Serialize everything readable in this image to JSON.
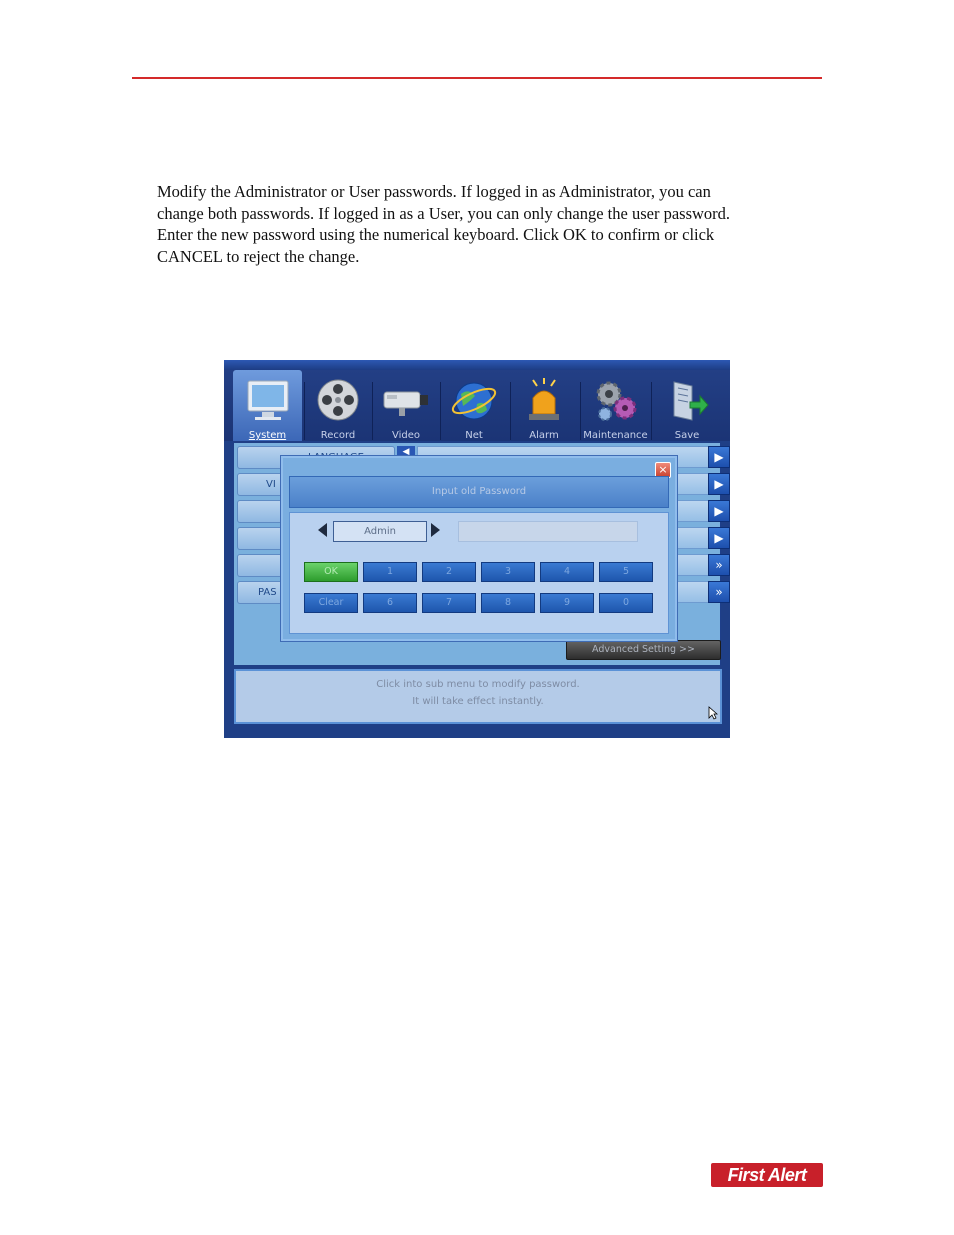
{
  "document": {
    "paragraph_lines": [
      "Modify the Administrator or User passwords. If logged in as Administrator, you can",
      "change both passwords. If logged in as a User, you can only change the user password.",
      "Enter the new password using the numerical keyboard. Click OK to confirm or click",
      "CANCEL to reject the change."
    ],
    "logo_text": "First Alert"
  },
  "colors": {
    "header_rule": "#d42a2a",
    "brand_red": "#c8202a",
    "dvr_navy": "#1f3f86",
    "dvr_light_blue": "#7ab0dd",
    "ok_green": "#3fb23f"
  },
  "dvr": {
    "toolbar": [
      {
        "label": "System",
        "icon": "monitor-icon",
        "active": true
      },
      {
        "label": "Record",
        "icon": "film-reel-icon",
        "active": false
      },
      {
        "label": "Video",
        "icon": "camera-icon",
        "active": false
      },
      {
        "label": "Net",
        "icon": "globe-icon",
        "active": false
      },
      {
        "label": "Alarm",
        "icon": "siren-icon",
        "active": false
      },
      {
        "label": "Maintenance",
        "icon": "gears-icon",
        "active": false
      },
      {
        "label": "Save",
        "icon": "save-folder-icon",
        "active": false
      }
    ],
    "left_menu": [
      "LANGUAGE",
      "VI",
      "",
      "",
      "",
      "PAS"
    ],
    "advanced_button": "Advanced Setting >>",
    "footer_lines": [
      "Click into sub menu to modify password.",
      "It will take effect instantly."
    ],
    "dialog": {
      "title": "Input old Password",
      "close_glyph": "×",
      "user_value": "Admin",
      "keys_row1": [
        "OK",
        "1",
        "2",
        "3",
        "4",
        "5"
      ],
      "keys_row2": [
        "Clear",
        "6",
        "7",
        "8",
        "9",
        "0"
      ]
    }
  }
}
